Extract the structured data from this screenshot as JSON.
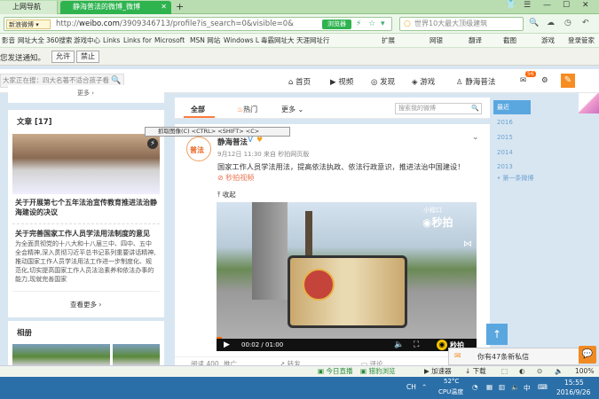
{
  "browser": {
    "tabs": [
      {
        "label": "上网导航"
      },
      {
        "label": "静海普法的微博_微博"
      }
    ],
    "new_tab": "+",
    "sina_badge": "新浪微博",
    "url_prefix": "http://",
    "url_domain": "weibo.com",
    "url_path": "/3909346713/profile?is_search=0&visible=0&",
    "go_button": "浏览器",
    "search_placeholder": "世界10大最大顶级建筑",
    "bookmarks": [
      "影音",
      "网址大全",
      "360搜索",
      "游戏中心",
      "Links",
      "Links for",
      "Microsoft",
      "MSN 网站",
      "Windows L",
      "毒霸网址大",
      "天涯网址行"
    ],
    "right_tools": [
      "扩展",
      "网银",
      "翻译",
      "截图",
      "游戏",
      "登录管家"
    ]
  },
  "notify": {
    "text": "您发送通知。",
    "allow": "允许",
    "deny": "禁止"
  },
  "weibo_nav": {
    "search_placeholder": "大家正在搜：四大名著不适合孩子看",
    "home": "首页",
    "video": "视频",
    "discover": "发现",
    "games": "游戏",
    "user": "静海普法",
    "msg_badge": "56"
  },
  "left": {
    "more_top": "更多",
    "articles_title": "文章 [17]",
    "article1_title": "关于开展第七个五年法治宣传教育推进法治静海建设的决议",
    "article2_title": "关于完善国家工作人员学法用法制度的意见",
    "article2_body": "为全面贯彻党的十八大和十八届三中、四中、五中全会精神,深入贯彻习近平总书记系列重要讲话精神,推动国家工作人员学法用法工作进一步制度化、规范化,切实提高国家工作人员法治素养和依法办事的能力,现就完善国家",
    "see_more": "查看更多",
    "album_title": "相册"
  },
  "feed": {
    "tabs": [
      "全部",
      "热门",
      "更多"
    ],
    "search_placeholder": "搜索我的微博",
    "context_menu": "抓取图像(C)  <CTRL> <SHIFT> <C>"
  },
  "post": {
    "author": "静海普法",
    "meta": "9月12日 11:30 来自 秒拍网页版",
    "content": "国家工作人员学法用法，提高依法执政、依法行政意识，推进法治中国建设！",
    "video_link": "秒拍视频",
    "collapse": "收起",
    "video_watermark": "秒拍",
    "video_tag": "小程口",
    "time_played": "00:02",
    "time_total": "01:00",
    "video_brand": "秒拍",
    "read_count": "阅读 400",
    "promote": "推广",
    "forward": "转发",
    "comment": "评论"
  },
  "timeline": {
    "label": "最近",
    "years": [
      "2016",
      "2015",
      "2014",
      "2013"
    ],
    "first": "第一条微博"
  },
  "message_popup": {
    "text": "你有47条新私信"
  },
  "statusbar": {
    "items": [
      "今日直播",
      "猎豹浏览",
      "加速器",
      "下载"
    ],
    "zoom": "100%"
  },
  "taskbar": {
    "cpu_temp": "52°C",
    "cpu_label": "CPU温度",
    "time": "15:55",
    "date": "2016/9/26",
    "lang": "CH"
  }
}
